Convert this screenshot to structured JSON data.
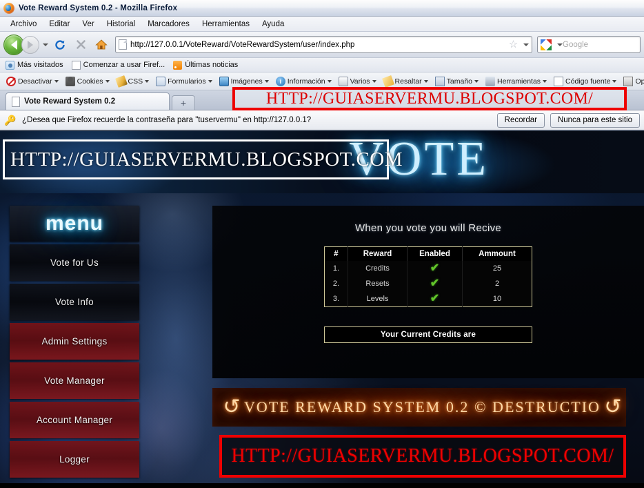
{
  "window": {
    "title": "Vote Reward System 0.2 - Mozilla Firefox",
    "app_icon": "firefox-icon"
  },
  "menubar": {
    "items": [
      {
        "label": "Archivo",
        "accel": "A"
      },
      {
        "label": "Editar",
        "accel": "E"
      },
      {
        "label": "Ver",
        "accel": "V"
      },
      {
        "label": "Historial",
        "accel": "s"
      },
      {
        "label": "Marcadores",
        "accel": "M"
      },
      {
        "label": "Herramientas",
        "accel": "a"
      },
      {
        "label": "Ayuda",
        "accel": "u"
      }
    ]
  },
  "navbar": {
    "back_icon": "back-arrow-icon",
    "forward_icon": "forward-arrow-icon",
    "dropdown_icon": "chevron-down-icon",
    "reload_icon": "reload-icon",
    "stop_icon": "stop-icon",
    "home_icon": "home-icon",
    "page_icon": "page-icon",
    "url": "http://127.0.0.1/VoteReward/VoteRewardSystem/user/index.php",
    "bookmark_star_icon": "star-icon",
    "search_engine_icon": "google-icon",
    "search_placeholder": "Google"
  },
  "bookmarks": {
    "items": [
      {
        "label": "Más visitados",
        "icon": "most-visited-icon"
      },
      {
        "label": "Comenzar a usar Firef...",
        "icon": "page-icon"
      },
      {
        "label": "Últimas noticias",
        "icon": "rss-icon"
      }
    ]
  },
  "devtoolbar": {
    "items": [
      {
        "label": "Desactivar",
        "icon": "disable-icon"
      },
      {
        "label": "Cookies",
        "icon": "cookies-icon"
      },
      {
        "label": "CSS",
        "icon": "css-icon"
      },
      {
        "label": "Formularios",
        "icon": "forms-icon"
      },
      {
        "label": "Imágenes",
        "icon": "images-icon"
      },
      {
        "label": "Información",
        "icon": "information-icon"
      },
      {
        "label": "Varios",
        "icon": "misc-icon"
      },
      {
        "label": "Resaltar",
        "icon": "highlight-icon"
      },
      {
        "label": "Tamaño",
        "icon": "resize-icon"
      },
      {
        "label": "Herramientas",
        "icon": "tools-icon"
      },
      {
        "label": "Código fuente",
        "icon": "source-icon"
      },
      {
        "label": "Opciones",
        "icon": "options-icon"
      }
    ]
  },
  "tabs": {
    "active": {
      "label": "Vote Reward System 0.2",
      "icon": "page-icon"
    },
    "new_tab_label": "+"
  },
  "notification": {
    "icon": "key-icon",
    "message": "¿Desea que Firefox recuerde la contraseña para \"tuservermu\" en http://127.0.0.1?",
    "remember_label": "Recordar",
    "never_label": "Nunca para este sitio"
  },
  "watermark": {
    "chrome_text": "HTTP://GUIASERVERMU.BLOGSPOT.COM/",
    "banner_text": "HTTP://GUIASERVERMU.BLOGSPOT.COM",
    "bottom_text": "HTTP://GUIASERVERMU.BLOGSPOT.COM/",
    "border_color": "#ee0000",
    "banner_border_color": "#ffffff"
  },
  "site": {
    "banner_logo": "VOTE",
    "sidebar": {
      "header": "menu",
      "items": [
        {
          "label": "Vote for Us",
          "style": "dark"
        },
        {
          "label": "Vote Info",
          "style": "dark"
        },
        {
          "label": "Admin Settings",
          "style": "red"
        },
        {
          "label": "Vote Manager",
          "style": "red"
        },
        {
          "label": "Account Manager",
          "style": "red"
        },
        {
          "label": "Logger",
          "style": "red"
        }
      ]
    },
    "main": {
      "title": "When you vote you will Recive",
      "table": {
        "headers": [
          "#",
          "Reward",
          "Enabled",
          "Ammount"
        ],
        "rows": [
          {
            "index": "1.",
            "reward": "Credits",
            "enabled": "✔",
            "ammount": "25"
          },
          {
            "index": "2.",
            "reward": "Resets",
            "enabled": "✔",
            "ammount": "2"
          },
          {
            "index": "3.",
            "reward": "Levels",
            "enabled": "✔",
            "ammount": "10"
          }
        ]
      },
      "credits_label": "Your Current Credits are"
    },
    "footer": {
      "text": "VOTE REWARD SYSTEM 0.2 © DESTRUCTIO",
      "left_icon": "swirl-arrow-icon",
      "right_icon": "swirl-arrow-icon",
      "glyph": "↺"
    }
  },
  "colors": {
    "accent_blue": "#26b6f0",
    "menu_red": "#761216",
    "footer_orange": "#ff9a3c",
    "check_green": "#62c52a",
    "watermark_red": "#ee0000"
  }
}
